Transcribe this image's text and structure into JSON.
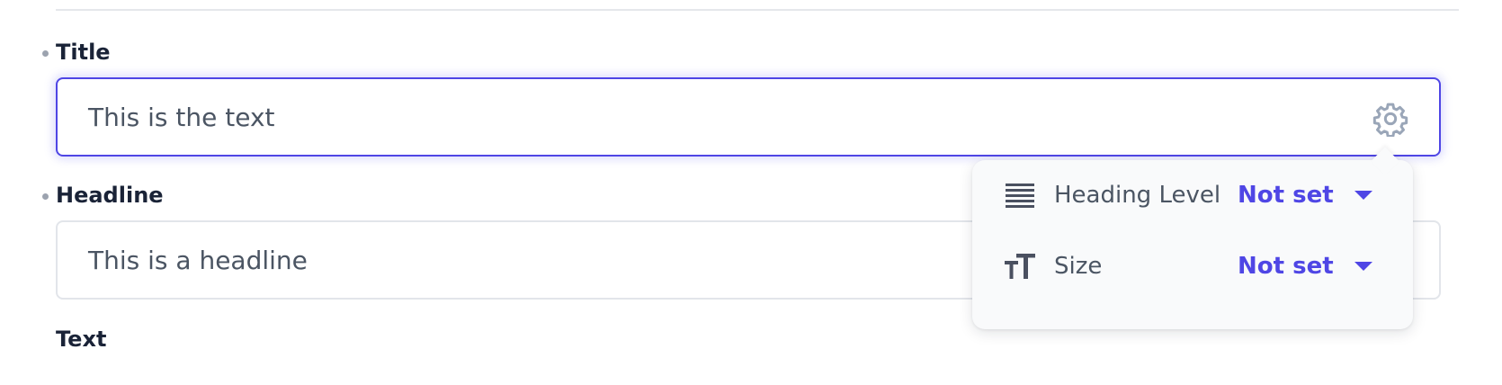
{
  "fields": {
    "title": {
      "label": "Title",
      "value": "This is the text",
      "focused": true
    },
    "headline": {
      "label": "Headline",
      "value": "This is a headline"
    },
    "text": {
      "label": "Text"
    }
  },
  "popover": {
    "heading_level": {
      "icon": "heading-lines-icon",
      "label": "Heading Level",
      "value": "Not set"
    },
    "size": {
      "icon": "text-size-icon",
      "label": "Size",
      "value": "Not set"
    }
  },
  "colors": {
    "accent": "#4f46e5",
    "label": "#1a2337",
    "muted_text": "#4b5563",
    "icon_gray": "#9aa6b8",
    "border": "#e2e5ea"
  }
}
